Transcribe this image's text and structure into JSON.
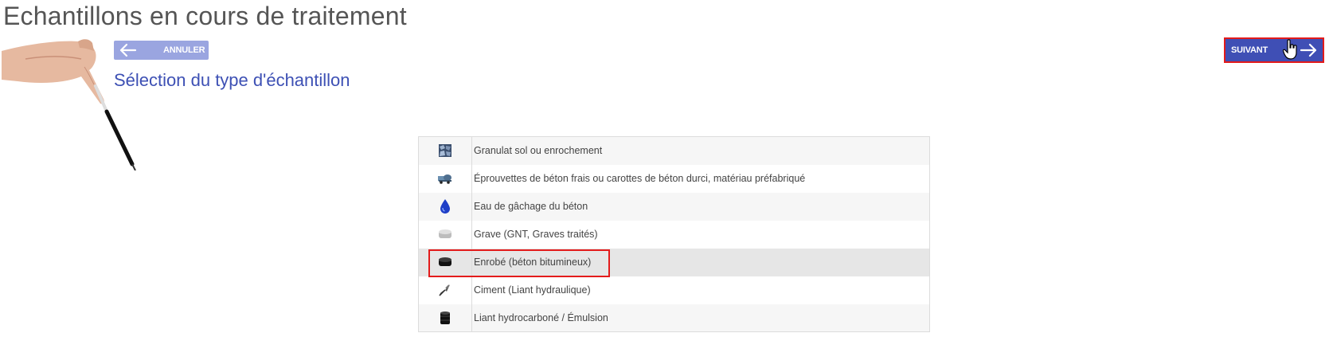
{
  "page": {
    "title": "Echantillons en cours de traitement",
    "subtitle": "Sélection du type d'échantillon"
  },
  "toolbar": {
    "cancel_label": "ANNULER",
    "next_label": "SUIVANT"
  },
  "colors": {
    "primary": "#3f4fb5",
    "cancel_bg": "#9aa5e0",
    "subtitle": "#3d50b4",
    "highlight": "#e31b1b",
    "row_selected": "#e6e6e6"
  },
  "sample_types": [
    {
      "icon": "granulate-icon",
      "label": "Granulat sol ou enrochement",
      "selected": false
    },
    {
      "icon": "concrete-mixer-icon",
      "label": "Éprouvettes de béton frais ou carottes de béton durci, matériau préfabriqué",
      "selected": false
    },
    {
      "icon": "water-drop-icon",
      "label": "Eau de gâchage du béton",
      "selected": false
    },
    {
      "icon": "grave-disc-icon",
      "label": "Grave (GNT, Graves traités)",
      "selected": false
    },
    {
      "icon": "asphalt-disc-icon",
      "label": "Enrobé (béton bitumineux)",
      "selected": true
    },
    {
      "icon": "trowel-icon",
      "label": "Ciment (Liant hydraulique)",
      "selected": false
    },
    {
      "icon": "barrel-icon",
      "label": "Liant hydrocarboné / Émulsion",
      "selected": false
    }
  ]
}
